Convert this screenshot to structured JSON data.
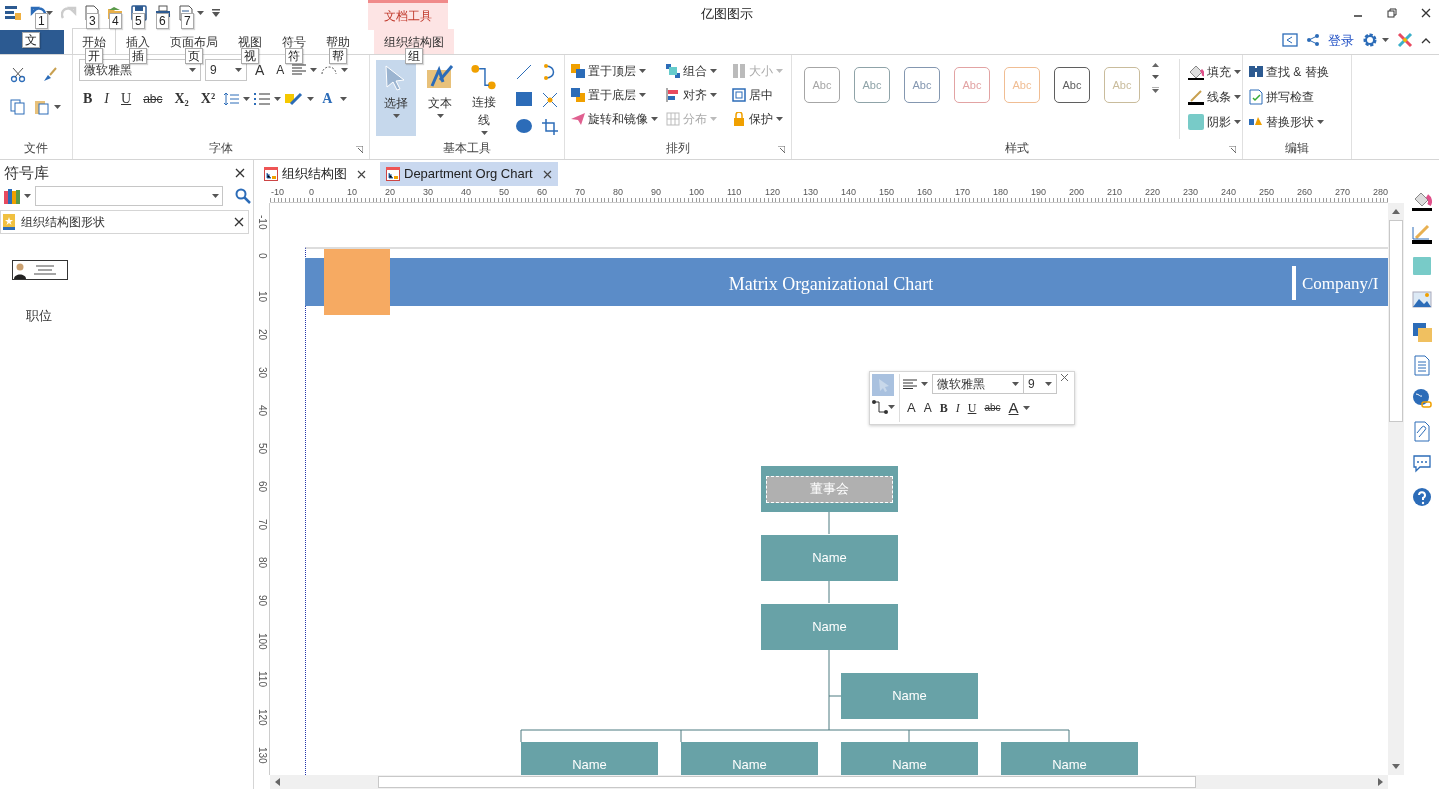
{
  "title_bar": {
    "title": "亿图图示",
    "context_tab": "文档工具",
    "quick_access_keytips": [
      "1",
      "3",
      "4",
      "5",
      "6",
      "7"
    ]
  },
  "tabs": [
    {
      "kind": "file",
      "keytip": "文"
    },
    {
      "kind": "tab",
      "label": "开始",
      "keytip": "开",
      "selected": true
    },
    {
      "kind": "tab",
      "label": "插入",
      "keytip": "插",
      "selected": false
    },
    {
      "kind": "tab",
      "label": "页面布局",
      "keytip": "页",
      "selected": false
    },
    {
      "kind": "tab",
      "label": "视图",
      "keytip": "视",
      "selected": false
    },
    {
      "kind": "tab",
      "label": "符号",
      "keytip": "符",
      "selected": false
    },
    {
      "kind": "tab",
      "label": "帮助",
      "keytip": "帮",
      "selected": false
    },
    {
      "kind": "context",
      "label": "组织结构图",
      "keytip": "组",
      "selected": false
    }
  ],
  "account": {
    "login": "登录"
  },
  "ribbon": {
    "file_group": {
      "label": "文件"
    },
    "font_group": {
      "label": "字体",
      "font": "微软雅黑",
      "size": "9",
      "grow": "A",
      "shrink": "A",
      "format_buttons": [
        "B",
        "I",
        "U",
        "abc",
        "X₂",
        "X²"
      ],
      "font_color": "A"
    },
    "tools_group": {
      "label": "基本工具",
      "tools": [
        {
          "label": "选择",
          "selected": true
        },
        {
          "label": "文本",
          "selected": false
        },
        {
          "label": "连接线",
          "selected": false
        }
      ]
    },
    "arrange_group": {
      "label": "排列",
      "items": [
        {
          "label": "置于顶层",
          "dropdown": true,
          "disabled": false
        },
        {
          "label": "组合",
          "dropdown": true,
          "disabled": false
        },
        {
          "label": "大小",
          "dropdown": true,
          "disabled": true
        },
        {
          "label": "置于底层",
          "dropdown": true,
          "disabled": false
        },
        {
          "label": "对齐",
          "dropdown": true,
          "disabled": false
        },
        {
          "label": "居中",
          "dropdown": false,
          "disabled": false
        },
        {
          "label": "旋转和镜像",
          "dropdown": true,
          "disabled": false
        },
        {
          "label": "分布",
          "dropdown": true,
          "disabled": true
        },
        {
          "label": "保护",
          "dropdown": true,
          "disabled": false
        }
      ]
    },
    "styles_group": {
      "label": "样式",
      "styles": [
        {
          "label": "Abc",
          "color": "#a6a6a6"
        },
        {
          "label": "Abc",
          "color": "#8fa3a8"
        },
        {
          "label": "Abc",
          "color": "#8497b0"
        },
        {
          "label": "Abc",
          "color": "#e2a3a3"
        },
        {
          "label": "Abc",
          "color": "#f0bd93"
        },
        {
          "label": "Abc",
          "color": "#5f5f5f"
        },
        {
          "label": "Abc",
          "color": "#c9bc9c"
        }
      ],
      "fill_items": [
        "填充",
        "线条",
        "阴影"
      ]
    },
    "edit_group": {
      "label": "编辑",
      "items": [
        "查找 & 替换",
        "拼写检查",
        "替换形状"
      ]
    }
  },
  "library": {
    "title": "符号库",
    "section": "组织结构图形状",
    "shapes": [
      {
        "label": "职位"
      }
    ]
  },
  "doc_tabs": [
    {
      "label": "组织结构图",
      "selected": false
    },
    {
      "label": "Department Org Chart",
      "selected": true
    }
  ],
  "ruler": {
    "horizontal": [
      "-10",
      "0",
      "10",
      "20",
      "30",
      "40",
      "50",
      "60",
      "70",
      "80",
      "90",
      "100",
      "110",
      "120",
      "130",
      "140",
      "150",
      "160",
      "170",
      "180",
      "190",
      "200",
      "210",
      "220",
      "230",
      "240",
      "250",
      "260",
      "270",
      "280"
    ],
    "vertical": [
      "-10",
      "0",
      "10",
      "20",
      "30",
      "40",
      "50",
      "60",
      "70",
      "80",
      "90",
      "100",
      "110",
      "120",
      "130"
    ]
  },
  "page": {
    "title": "Matrix Organizational Chart",
    "company": "Company/I"
  },
  "floating_toolbar": {
    "font": "微软雅黑",
    "size": "9",
    "grow": "A",
    "shrink": "A",
    "format_buttons": [
      "B",
      "I",
      "U",
      "abc"
    ],
    "font_color": "A"
  },
  "org_chart": {
    "nodes": [
      {
        "label": "董事会",
        "selected": true
      },
      {
        "label": "Name",
        "selected": false
      },
      {
        "label": "Name",
        "selected": false
      },
      {
        "label": "Name",
        "selected": false
      },
      {
        "label": "Name",
        "selected": false
      },
      {
        "label": "Name",
        "selected": false
      },
      {
        "label": "Name",
        "selected": false
      },
      {
        "label": "Name",
        "selected": false
      }
    ]
  }
}
